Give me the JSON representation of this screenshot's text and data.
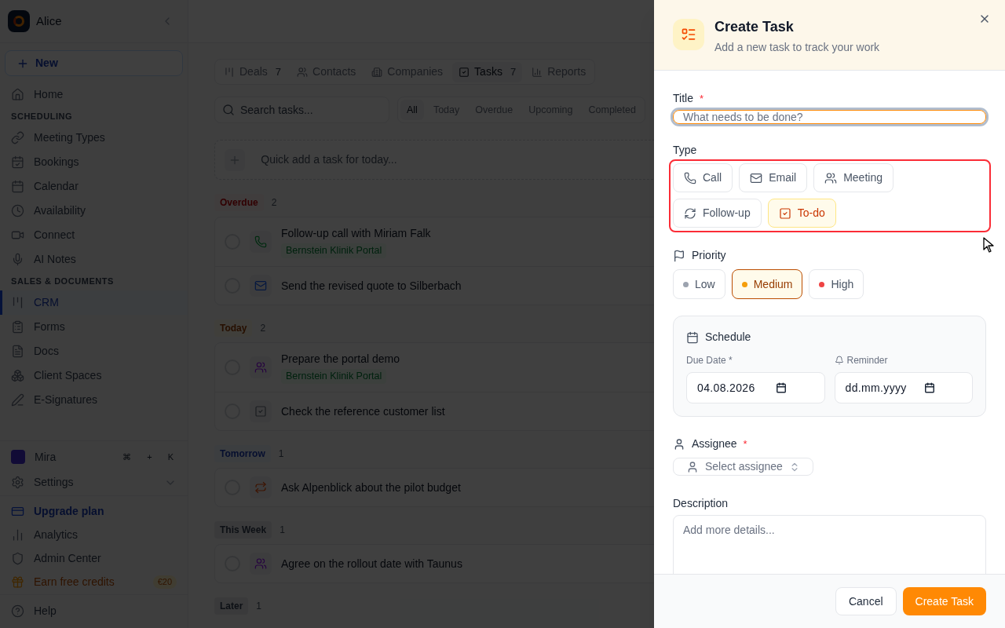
{
  "sidebar": {
    "workspace": "Alice",
    "new_button": "New",
    "items": [
      {
        "kind": "link",
        "label": "Home",
        "selected": false
      },
      {
        "kind": "section",
        "label": "SCHEDULING"
      },
      {
        "kind": "link",
        "label": "Meeting Types",
        "selected": false
      },
      {
        "kind": "link",
        "label": "Bookings",
        "selected": false
      },
      {
        "kind": "link",
        "label": "Calendar",
        "selected": false
      },
      {
        "kind": "link",
        "label": "Availability",
        "selected": false
      },
      {
        "kind": "link",
        "label": "Connect",
        "selected": false
      },
      {
        "kind": "link",
        "label": "AI Notes",
        "selected": false
      },
      {
        "kind": "section",
        "label": "SALES & DOCUMENTS"
      },
      {
        "kind": "link",
        "label": "CRM",
        "selected": true
      },
      {
        "kind": "link",
        "label": "Forms",
        "selected": false
      },
      {
        "kind": "link",
        "label": "Docs",
        "selected": false
      },
      {
        "kind": "link",
        "label": "Client Spaces",
        "selected": false
      },
      {
        "kind": "link",
        "label": "E-Signatures",
        "selected": false
      }
    ],
    "footer": [
      {
        "kind": "assistant",
        "label": "Mira",
        "shortcut": [
          "⌘",
          "+",
          "K"
        ]
      },
      {
        "kind": "menu",
        "label": "Settings"
      },
      {
        "kind": "upgrade",
        "label": "Upgrade plan"
      },
      {
        "kind": "link",
        "label": "Analytics"
      },
      {
        "kind": "link",
        "label": "Admin Center"
      },
      {
        "kind": "reward",
        "label": "Earn free credits",
        "badge": "€20"
      },
      {
        "kind": "help",
        "label": "Help"
      }
    ]
  },
  "main": {
    "tabs": [
      {
        "label": "Deals",
        "count": "7",
        "selected": false
      },
      {
        "label": "Contacts",
        "selected": false
      },
      {
        "label": "Companies",
        "selected": false
      },
      {
        "label": "Tasks",
        "count": "7",
        "selected": true
      },
      {
        "label": "Reports",
        "selected": false
      }
    ],
    "search": {
      "placeholder": "Search tasks..."
    },
    "filters": [
      {
        "label": "All",
        "selected": true
      },
      {
        "label": "Today",
        "selected": false
      },
      {
        "label": "Overdue",
        "selected": false
      },
      {
        "label": "Upcoming",
        "selected": false
      },
      {
        "label": "Completed",
        "selected": false
      }
    ],
    "quick_add": {
      "placeholder": "Quick add a task for today..."
    },
    "groups": [
      {
        "label": "Overdue",
        "count": "2",
        "kind": "overdue",
        "tasks": [
          {
            "kind": "call",
            "title": "Follow-up call with Miriam Falk",
            "tag": "Bernstein Klinik Portal",
            "checked": false
          },
          {
            "kind": "email",
            "title": "Send the revised quote to Silberbach",
            "checked": false
          }
        ]
      },
      {
        "label": "Today",
        "count": "2",
        "kind": "today",
        "tasks": [
          {
            "kind": "meeting",
            "title": "Prepare the portal demo",
            "tag": "Bernstein Klinik Portal",
            "checked": false
          },
          {
            "kind": "todo",
            "title": "Check the reference customer list",
            "checked": false
          }
        ]
      },
      {
        "label": "Tomorrow",
        "count": "1",
        "kind": "tomorrow",
        "tasks": [
          {
            "kind": "followup",
            "title": "Ask Alpenblick about the pilot budget",
            "checked": false
          }
        ]
      },
      {
        "label": "This Week",
        "count": "1",
        "kind": "neutral",
        "tasks": [
          {
            "kind": "meeting",
            "title": "Agree on the rollout date with Taunus",
            "checked": false
          }
        ]
      },
      {
        "label": "Later",
        "count": "1",
        "kind": "neutral"
      }
    ]
  },
  "dialog": {
    "title": "Create Task",
    "subtitle": "Add a new task to track your work",
    "title_field": {
      "label": "Title",
      "required_mark": "*",
      "placeholder": "What needs to be done?",
      "focused": true
    },
    "type_field": {
      "label": "Type",
      "options": [
        {
          "kind": "call",
          "label": "Call",
          "selected": false
        },
        {
          "kind": "email",
          "label": "Email",
          "selected": false
        },
        {
          "kind": "meeting",
          "label": "Meeting",
          "selected": false
        },
        {
          "kind": "followup",
          "label": "Follow-up",
          "selected": false
        },
        {
          "kind": "todo",
          "label": "To-do",
          "selected": true
        }
      ]
    },
    "priority_field": {
      "label": "Priority",
      "options": [
        {
          "label": "Low",
          "color": "#9ca3af",
          "selected": false
        },
        {
          "label": "Medium",
          "color": "#f59e0b",
          "selected": true
        },
        {
          "label": "High",
          "color": "#ef4444",
          "selected": false
        }
      ]
    },
    "schedule": {
      "title": "Schedule",
      "due_label": "Due Date *",
      "due_value": "04.08.2026",
      "reminder_label": "Reminder",
      "reminder_value": "dd.mm.yyyy"
    },
    "assignee": {
      "label": "Assignee",
      "required_mark": "*",
      "placeholder": "Select assignee"
    },
    "description": {
      "label": "Description",
      "placeholder": "Add more details..."
    },
    "buttons": [
      {
        "kind": "secondary",
        "label": "Cancel"
      },
      {
        "kind": "primary",
        "label": "Create Task"
      }
    ]
  }
}
